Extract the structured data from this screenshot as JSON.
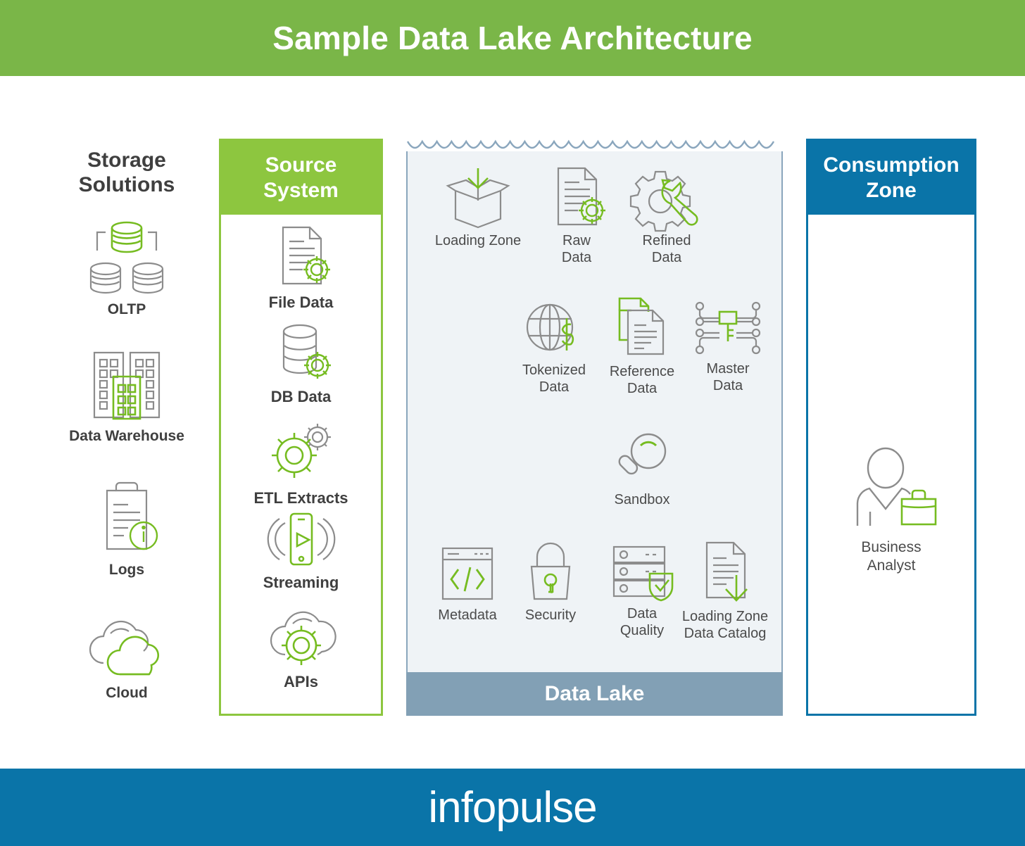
{
  "header": {
    "title": "Sample Data Lake Architecture",
    "bg_color": "#7ab648"
  },
  "footer": {
    "logo": "infopulse",
    "bg_color": "#0a74a8"
  },
  "colors": {
    "green": "#8dc63f",
    "header_green": "#7ab648",
    "blue": "#0a74a8",
    "lake_bg": "#eff3f6",
    "lake_footer": "#82a0b5",
    "lake_border": "#8aa6bd",
    "gray_line": "#8c8c8c",
    "text_dark": "#3f3f3f"
  },
  "storage": {
    "title": "Storage\nSolutions",
    "title_line1": "Storage",
    "title_line2": "Solutions",
    "items": [
      {
        "label": "OLTP",
        "icon": "databases-icon"
      },
      {
        "label": "Data Warehouse",
        "icon": "buildings-icon"
      },
      {
        "label": "Logs",
        "icon": "clipboard-info-icon"
      },
      {
        "label": "Cloud",
        "icon": "clouds-icon"
      }
    ]
  },
  "source_system": {
    "title_line1": "Source",
    "title_line2": "System",
    "items": [
      {
        "label": "File Data",
        "icon": "document-gear-icon"
      },
      {
        "label": "DB Data",
        "icon": "database-gear-icon"
      },
      {
        "label": "ETL Extracts",
        "icon": "gears-icon"
      },
      {
        "label": "Streaming",
        "icon": "mobile-stream-icon"
      },
      {
        "label": "APIs",
        "icon": "cloud-gear-icon"
      }
    ]
  },
  "data_lake": {
    "footer_label": "Data Lake",
    "rows": [
      [
        {
          "label_line1": "Loading Zone",
          "label_line2": "",
          "icon": "box-download-icon"
        },
        {
          "label_line1": "Raw",
          "label_line2": "Data",
          "icon": "document-gear-icon"
        },
        {
          "label_line1": "Refined",
          "label_line2": "Data",
          "icon": "gear-wrench-icon"
        }
      ],
      [
        {
          "label_line1": "Tokenized",
          "label_line2": "Data",
          "icon": "globe-dollar-icon"
        },
        {
          "label_line1": "Reference",
          "label_line2": "Data",
          "icon": "documents-icon"
        },
        {
          "label_line1": "Master",
          "label_line2": "Data",
          "icon": "network-node-icon"
        }
      ],
      [
        {
          "label_line1": "Sandbox",
          "label_line2": "",
          "icon": "magnifier-icon"
        }
      ],
      [
        {
          "label_line1": "Metadata",
          "label_line2": "",
          "icon": "code-window-icon"
        },
        {
          "label_line1": "Security",
          "label_line2": "",
          "icon": "lock-icon"
        },
        {
          "label_line1": "Data",
          "label_line2": "Quality",
          "icon": "server-shield-icon"
        },
        {
          "label_line1": "Loading Zone",
          "label_line2": "Data Catalog",
          "icon": "document-download-icon"
        }
      ]
    ]
  },
  "consumption_zone": {
    "title_line1": "Consumption",
    "title_line2": "Zone",
    "items": [
      {
        "label_line1": "Business",
        "label_line2": "Analyst",
        "icon": "business-person-icon"
      }
    ]
  }
}
